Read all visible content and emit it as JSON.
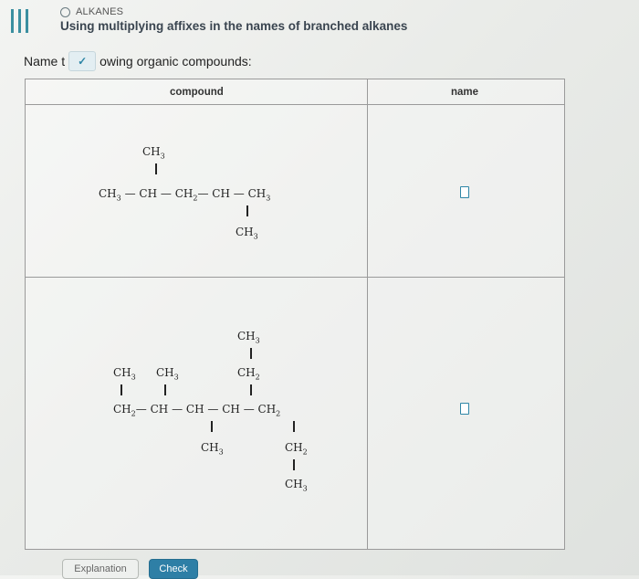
{
  "header": {
    "topic": "ALKANES",
    "title": "Using multiplying affixes in the names of branched alkanes"
  },
  "prompt": {
    "prefix": "Name t",
    "suffix": "owing organic compounds:"
  },
  "table": {
    "headers": {
      "compound": "compound",
      "name": "name"
    },
    "compound1": {
      "top_sub": [
        "CH",
        "3"
      ],
      "main": [
        [
          "CH",
          "3",
          "—"
        ],
        [
          "CH",
          "",
          "—"
        ],
        [
          "CH",
          "2",
          "—"
        ],
        [
          "CH",
          "",
          "—"
        ],
        [
          "CH",
          "3",
          ""
        ]
      ],
      "bottom_sub": [
        "CH",
        "3"
      ]
    },
    "compound2": {
      "top": [
        "CH",
        "3"
      ],
      "top2": [
        "CH",
        "2"
      ],
      "left1": [
        "CH",
        "3"
      ],
      "left2": [
        "CH",
        "3"
      ],
      "main": [
        [
          "CH",
          "2",
          "—"
        ],
        [
          "CH",
          "",
          "—"
        ],
        [
          "CH",
          "",
          "—"
        ],
        [
          "CH",
          "",
          "—"
        ],
        [
          "CH",
          "2",
          ""
        ]
      ],
      "below_ch": [
        "CH",
        "3"
      ],
      "right1": [
        "CH",
        "2"
      ],
      "right2": [
        "CH",
        "3"
      ]
    }
  },
  "buttons": {
    "explanation": "Explanation",
    "check": "Check"
  },
  "colors": {
    "accent": "#2e86a6",
    "check_bg": "#2e7fa6"
  }
}
